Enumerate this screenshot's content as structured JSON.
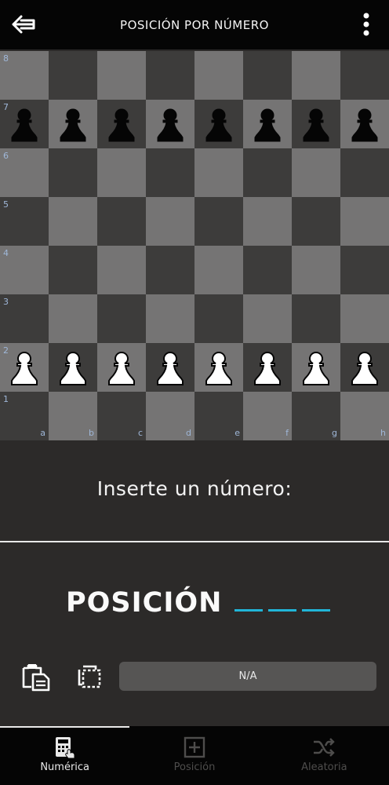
{
  "header": {
    "title": "POSICIÓN POR NÚMERO",
    "back_icon": "back-arrow-icon",
    "menu_icon": "more-vertical-icon"
  },
  "board": {
    "ranks": [
      "8",
      "7",
      "6",
      "5",
      "4",
      "3",
      "2",
      "1"
    ],
    "files": [
      "a",
      "b",
      "c",
      "d",
      "e",
      "f",
      "g",
      "h"
    ],
    "pieces": {
      "a7": "black-pawn",
      "b7": "black-pawn",
      "c7": "black-pawn",
      "d7": "black-pawn",
      "e7": "black-pawn",
      "f7": "black-pawn",
      "g7": "black-pawn",
      "h7": "black-pawn",
      "a2": "white-pawn",
      "b2": "white-pawn",
      "c2": "white-pawn",
      "d2": "white-pawn",
      "e2": "white-pawn",
      "f2": "white-pawn",
      "g2": "white-pawn",
      "h2": "white-pawn"
    },
    "colors": {
      "light": "#757474",
      "dark": "#3d3c3b",
      "coord": "#9fb7d8"
    }
  },
  "prompt": {
    "text": "Inserte un número:"
  },
  "position_input": {
    "label": "POSICIÓN",
    "digit_slots": 3,
    "accent_color": "#21b5d8"
  },
  "actions": {
    "paste_icon": "paste-icon",
    "copy_icon": "copy-icon",
    "result_text": "N/A"
  },
  "bottom_nav": {
    "items": [
      {
        "label": "Numérica",
        "icon": "calculator-icon",
        "active": true
      },
      {
        "label": "Posición",
        "icon": "plus-square-icon",
        "active": false
      },
      {
        "label": "Aleatoria",
        "icon": "shuffle-icon",
        "active": false
      }
    ]
  }
}
